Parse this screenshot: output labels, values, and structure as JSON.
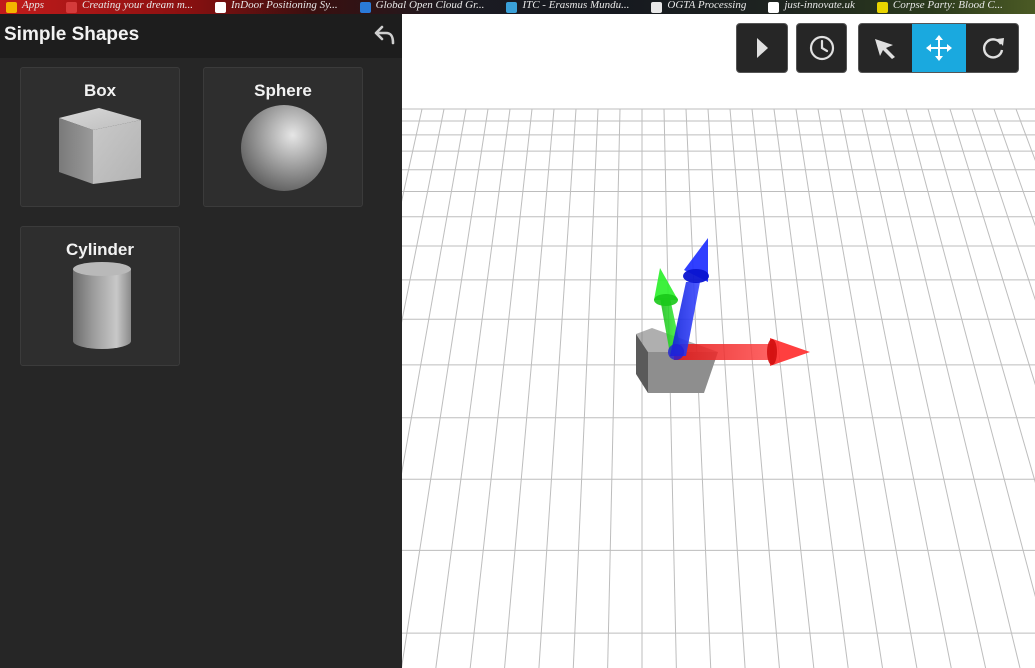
{
  "bookmarks": [
    {
      "label": "Apps",
      "color": "#f4b400"
    },
    {
      "label": "Creating your dream m...",
      "color": "#d43b3b"
    },
    {
      "label": "InDoor Positioning Sy...",
      "color": "#ffffff"
    },
    {
      "label": "Global Open Cloud Gr...",
      "color": "#2a7ad8"
    },
    {
      "label": "ITC - Erasmus Mundu...",
      "color": "#3aa0d8"
    },
    {
      "label": "OGTA Processing",
      "color": "#e8e8e8"
    },
    {
      "label": "just-innovate.uk",
      "color": "#ffffff"
    },
    {
      "label": "Corpse Party: Blood C...",
      "color": "#e8d400"
    }
  ],
  "panel": {
    "title": "Simple Shapes",
    "undo_icon": "undo-arrow-icon"
  },
  "shapes": [
    {
      "label": "Box",
      "icon": "box-icon"
    },
    {
      "label": "Sphere",
      "icon": "sphere-icon"
    },
    {
      "label": "Cylinder",
      "icon": "cylinder-icon"
    }
  ],
  "side_tabs": [
    {
      "icon": "hamburger-menu-icon",
      "active": false
    },
    {
      "icon": "plus-icon",
      "active": true
    },
    {
      "icon": "layers-tree-icon",
      "active": false
    }
  ],
  "toolbar": {
    "play_icon": "play-icon",
    "history_icon": "clock-icon",
    "modes": [
      {
        "icon": "select-arrow-icon",
        "active": false
      },
      {
        "icon": "move-arrows-icon",
        "active": true
      },
      {
        "icon": "rotate-icon",
        "active": false
      }
    ]
  },
  "colors": {
    "accent": "#1aa9df",
    "panel": "#262626",
    "axis_x": "#ff2020",
    "axis_y": "#10dd10",
    "axis_z": "#1a2aff"
  }
}
